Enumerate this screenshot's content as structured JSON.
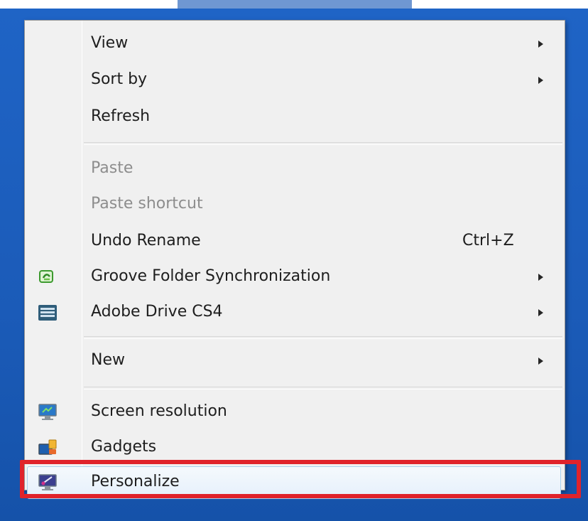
{
  "menu": {
    "items": [
      {
        "label": "View",
        "submenu": true
      },
      {
        "label": "Sort by",
        "submenu": true
      },
      {
        "label": "Refresh"
      },
      {
        "label": "Paste",
        "disabled": true
      },
      {
        "label": "Paste shortcut",
        "disabled": true
      },
      {
        "label": "Undo Rename",
        "shortcut": "Ctrl+Z"
      },
      {
        "label": "Groove Folder Synchronization",
        "submenu": true,
        "icon": "groove-icon"
      },
      {
        "label": "Adobe Drive CS4",
        "submenu": true,
        "icon": "adobe-drive-icon"
      },
      {
        "label": "New",
        "submenu": true
      },
      {
        "label": "Screen resolution",
        "icon": "screen-resolution-icon"
      },
      {
        "label": "Gadgets",
        "icon": "gadgets-icon"
      },
      {
        "label": "Personalize",
        "icon": "personalize-icon",
        "highlighted": true
      }
    ]
  },
  "annotation": {
    "highlight_color": "#e0232b",
    "target": "Personalize"
  },
  "colors": {
    "desktop": "#1f64c6",
    "menu_bg": "#f0f0f0",
    "disabled_text": "#8d8d8d"
  }
}
